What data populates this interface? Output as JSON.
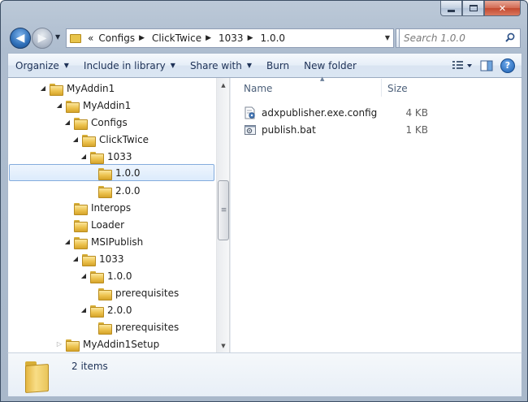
{
  "address": {
    "overflow": "«",
    "crumbs": [
      "Configs",
      "ClickTwice",
      "1033",
      "1.0.0"
    ]
  },
  "search": {
    "placeholder": "Search 1.0.0"
  },
  "toolbar": {
    "organize": "Organize",
    "include": "Include in library",
    "share": "Share with",
    "burn": "Burn",
    "new_folder": "New folder"
  },
  "tree": {
    "items": [
      {
        "label": "MyAddin1"
      },
      {
        "label": "MyAddin1"
      },
      {
        "label": "Configs"
      },
      {
        "label": "ClickTwice"
      },
      {
        "label": "1033"
      },
      {
        "label": "1.0.0"
      },
      {
        "label": "2.0.0"
      },
      {
        "label": "Interops"
      },
      {
        "label": "Loader"
      },
      {
        "label": "MSIPublish"
      },
      {
        "label": "1033"
      },
      {
        "label": "1.0.0"
      },
      {
        "label": "prerequisites"
      },
      {
        "label": "2.0.0"
      },
      {
        "label": "prerequisites"
      },
      {
        "label": "MyAddin1Setup"
      }
    ]
  },
  "files": {
    "columns": {
      "name": "Name",
      "size": "Size"
    },
    "rows": [
      {
        "name": "adxpublisher.exe.config",
        "size": "4 KB"
      },
      {
        "name": "publish.bat",
        "size": "1 KB"
      }
    ]
  },
  "details": {
    "count": "2 items"
  },
  "colors": {
    "selection_border": "#84acdd",
    "selection_fill": "#dcebfc",
    "folder": "#ecc24d",
    "link_text": "#1e3257"
  }
}
